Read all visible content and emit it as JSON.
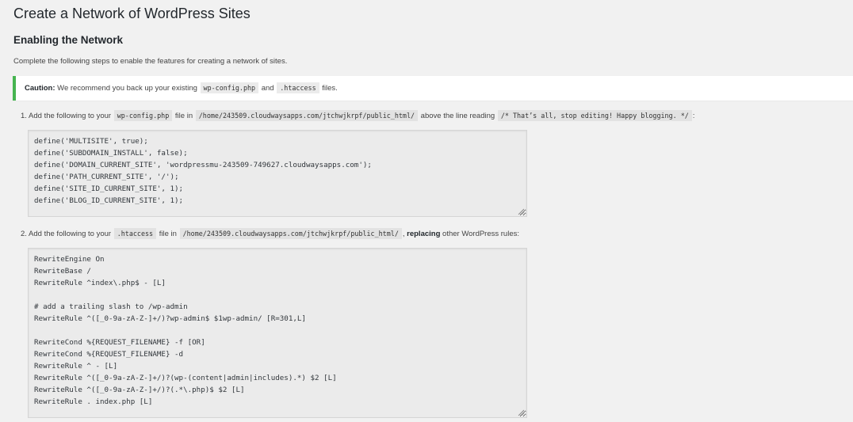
{
  "page": {
    "title": "Create a Network of WordPress Sites",
    "section_title": "Enabling the Network",
    "intro": "Complete the following steps to enable the features for creating a network of sites."
  },
  "notice": {
    "label": "Caution:",
    "text_before": " We recommend you back up your existing ",
    "file1": "wp-config.php",
    "text_mid": " and ",
    "file2": ".htaccess",
    "text_after": " files.",
    "border_color": "#46b450"
  },
  "step1": {
    "prefix": "1. Add the following to your ",
    "file": "wp-config.php",
    "mid1": " file in ",
    "path": "/home/243509.cloudwaysapps.com/jtchwjkrpf/public_html/",
    "mid2": " above the line reading ",
    "marker": "/* That’s all, stop editing! Happy blogging. */",
    "suffix": ":",
    "code": "define('MULTISITE', true);\ndefine('SUBDOMAIN_INSTALL', false);\ndefine('DOMAIN_CURRENT_SITE', 'wordpressmu-243509-749627.cloudwaysapps.com');\ndefine('PATH_CURRENT_SITE', '/');\ndefine('SITE_ID_CURRENT_SITE', 1);\ndefine('BLOG_ID_CURRENT_SITE', 1);"
  },
  "step2": {
    "prefix": "2. Add the following to your ",
    "file": ".htaccess",
    "mid1": " file in ",
    "path": "/home/243509.cloudwaysapps.com/jtchwjkrpf/public_html/",
    "mid2": ", ",
    "emphasis": "replacing",
    "suffix": " other WordPress rules:",
    "code": "RewriteEngine On\nRewriteBase /\nRewriteRule ^index\\.php$ - [L]\n\n# add a trailing slash to /wp-admin\nRewriteRule ^([_0-9a-zA-Z-]+/)?wp-admin$ $1wp-admin/ [R=301,L]\n\nRewriteCond %{REQUEST_FILENAME} -f [OR]\nRewriteCond %{REQUEST_FILENAME} -d\nRewriteRule ^ - [L]\nRewriteRule ^([_0-9a-zA-Z-]+/)?(wp-(content|admin|includes).*) $2 [L]\nRewriteRule ^([_0-9a-zA-Z-]+/)?(.*\\.php)$ $2 [L]\nRewriteRule . index.php [L]"
  },
  "icons": {
    "resize_handle": "resize-handle-icon"
  }
}
